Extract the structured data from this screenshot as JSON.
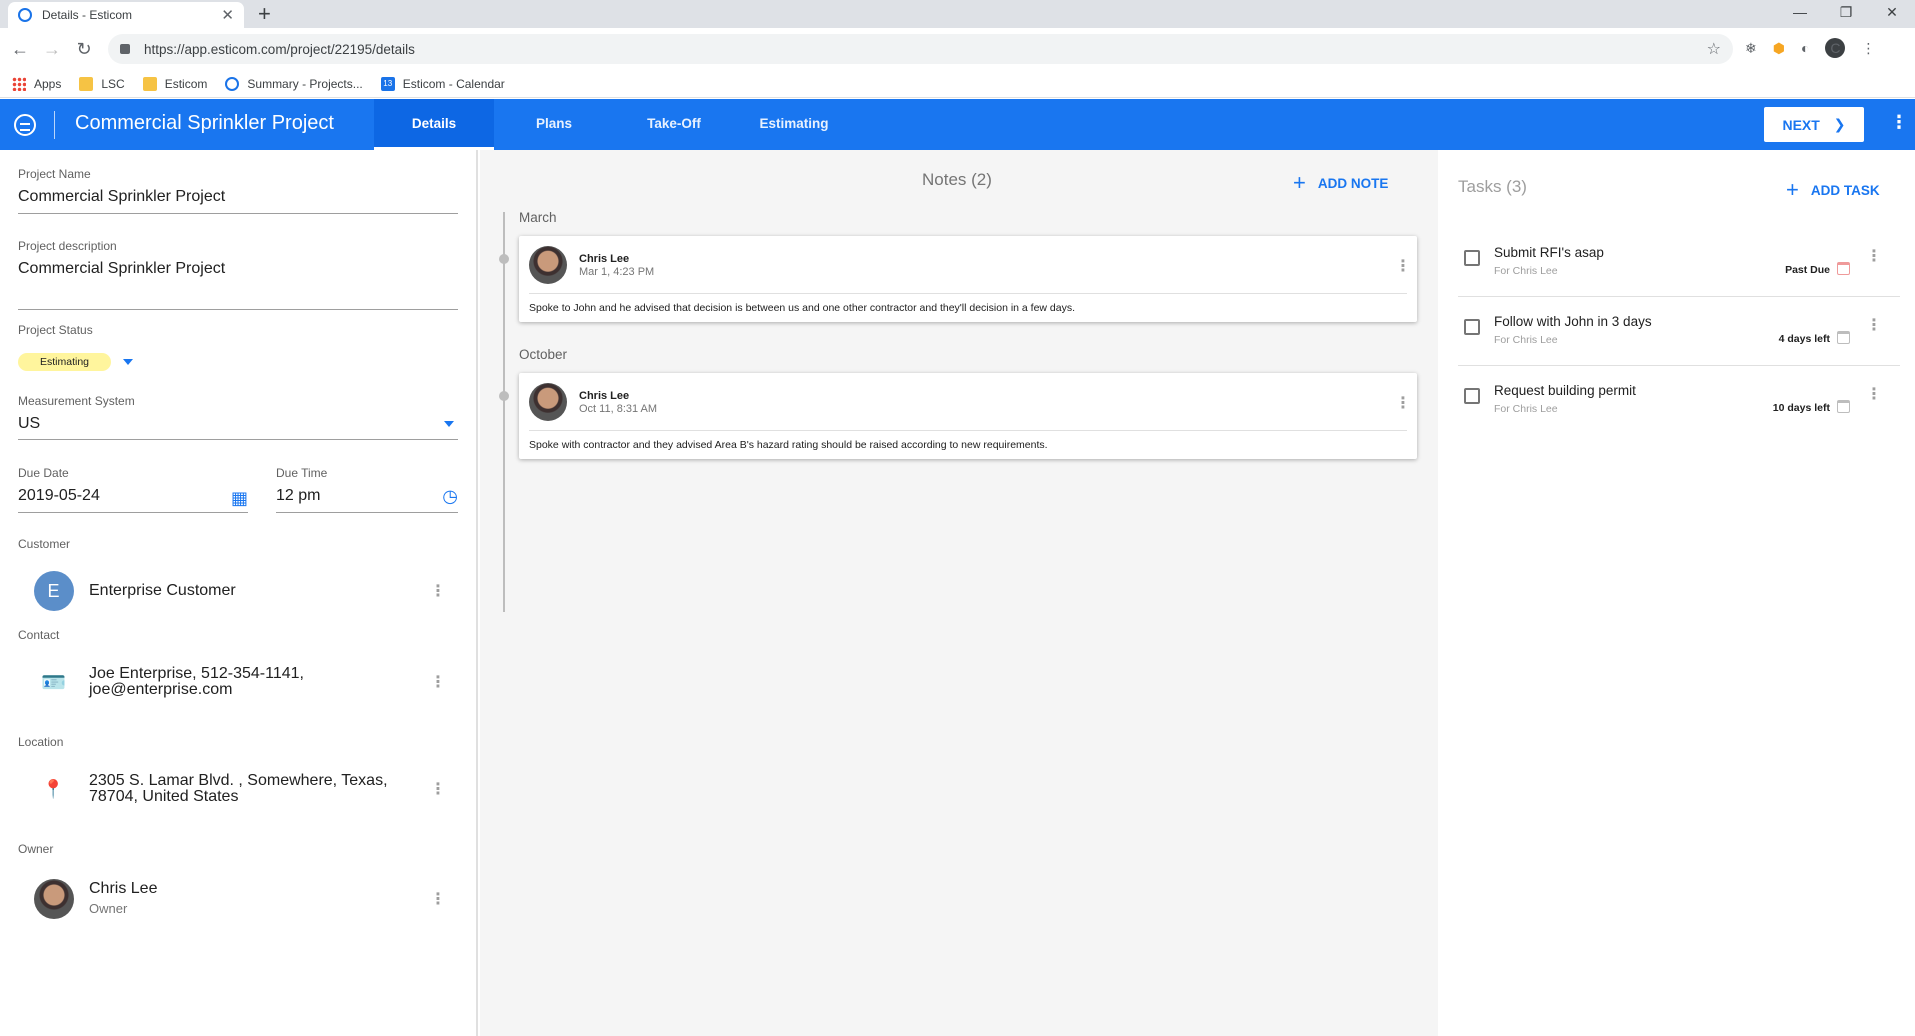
{
  "browser": {
    "tab_title": "Details - Esticom",
    "url": "https://app.esticom.com/project/22195/details",
    "profile_initial": "C",
    "bookmarks": [
      "Apps",
      "LSC",
      "Esticom",
      "Summary - Projects...",
      "Esticom - Calendar"
    ],
    "calendar_day": "13"
  },
  "appbar": {
    "title": "Commercial Sprinkler Project",
    "tabs": [
      "Details",
      "Plans",
      "Take-Off",
      "Estimating"
    ],
    "active_tab": "Details",
    "next_label": "NEXT"
  },
  "details": {
    "project_name_label": "Project Name",
    "project_name": "Commercial Sprinkler Project",
    "description_label": "Project description",
    "description": "Commercial Sprinkler Project",
    "status_label": "Project Status",
    "status": "Estimating",
    "measurement_label": "Measurement System",
    "measurement": "US",
    "due_date_label": "Due Date",
    "due_date": "2019-05-24",
    "due_time_label": "Due Time",
    "due_time": "12 pm",
    "customer_label": "Customer",
    "customer_initial": "E",
    "customer": "Enterprise Customer",
    "contact_label": "Contact",
    "contact_line1": "Joe Enterprise, 512-354-1141,",
    "contact_line2": "joe@enterprise.com",
    "location_label": "Location",
    "location_line1": "2305 S. Lamar Blvd. , Somewhere, Texas,",
    "location_line2": "78704, United States",
    "owner_label": "Owner",
    "owner_name": "Chris Lee",
    "owner_role": "Owner"
  },
  "notes": {
    "header": "Notes (2)",
    "add_label": "ADD NOTE",
    "groups": [
      {
        "month": "March",
        "author": "Chris Lee",
        "date": "Mar 1, 4:23 PM",
        "body": "Spoke to John and he advised that decision is between us and one other contractor and they'll decision in a few days."
      },
      {
        "month": "October",
        "author": "Chris Lee",
        "date": "Oct 11, 8:31 AM",
        "body": "Spoke with contractor and they advised Area B's hazard rating should be raised according to new requirements."
      }
    ]
  },
  "tasks": {
    "header": "Tasks (3)",
    "add_label": "ADD TASK",
    "items": [
      {
        "name": "Submit RFI's asap",
        "for": "For Chris Lee",
        "due": "Past Due"
      },
      {
        "name": "Follow with John in 3 days",
        "for": "For Chris Lee",
        "due": "4 days left"
      },
      {
        "name": "Request building permit",
        "for": "For Chris Lee",
        "due": "10 days left"
      }
    ]
  },
  "colors": {
    "brand": "#1976f0",
    "status_badge": "#fff59d",
    "past_due_icon": "#ef9a9a"
  }
}
